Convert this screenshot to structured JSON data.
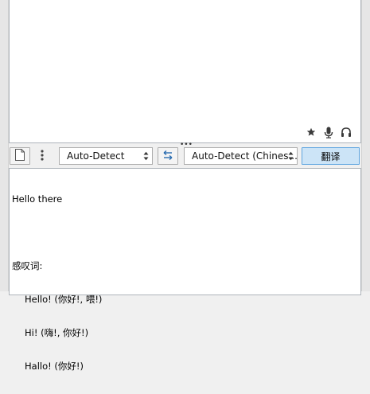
{
  "source": {
    "text": ""
  },
  "toolbar": {
    "source_language": "Auto-Detect",
    "target_language": "Auto-Detect (Chines...",
    "translate_label": "翻译"
  },
  "result": {
    "source_text": "Hello there",
    "category": "感叹词:",
    "entries": [
      "Hello! (你好!, 喂!)",
      "Hi! (嗨!, 你好!)",
      "Hallo! (你好!)"
    ]
  },
  "icons": {
    "favorite": "star-icon",
    "speak": "microphone-icon",
    "listen": "headphones-icon",
    "new_doc": "document-icon",
    "menu": "vertical-dots-icon",
    "swap": "swap-arrows-icon"
  },
  "colors": {
    "translate_bg": "#cce4f7",
    "translate_border": "#5fa5e0",
    "panel_border": "#aeb4bb",
    "window_bg": "#f0f0f0"
  }
}
